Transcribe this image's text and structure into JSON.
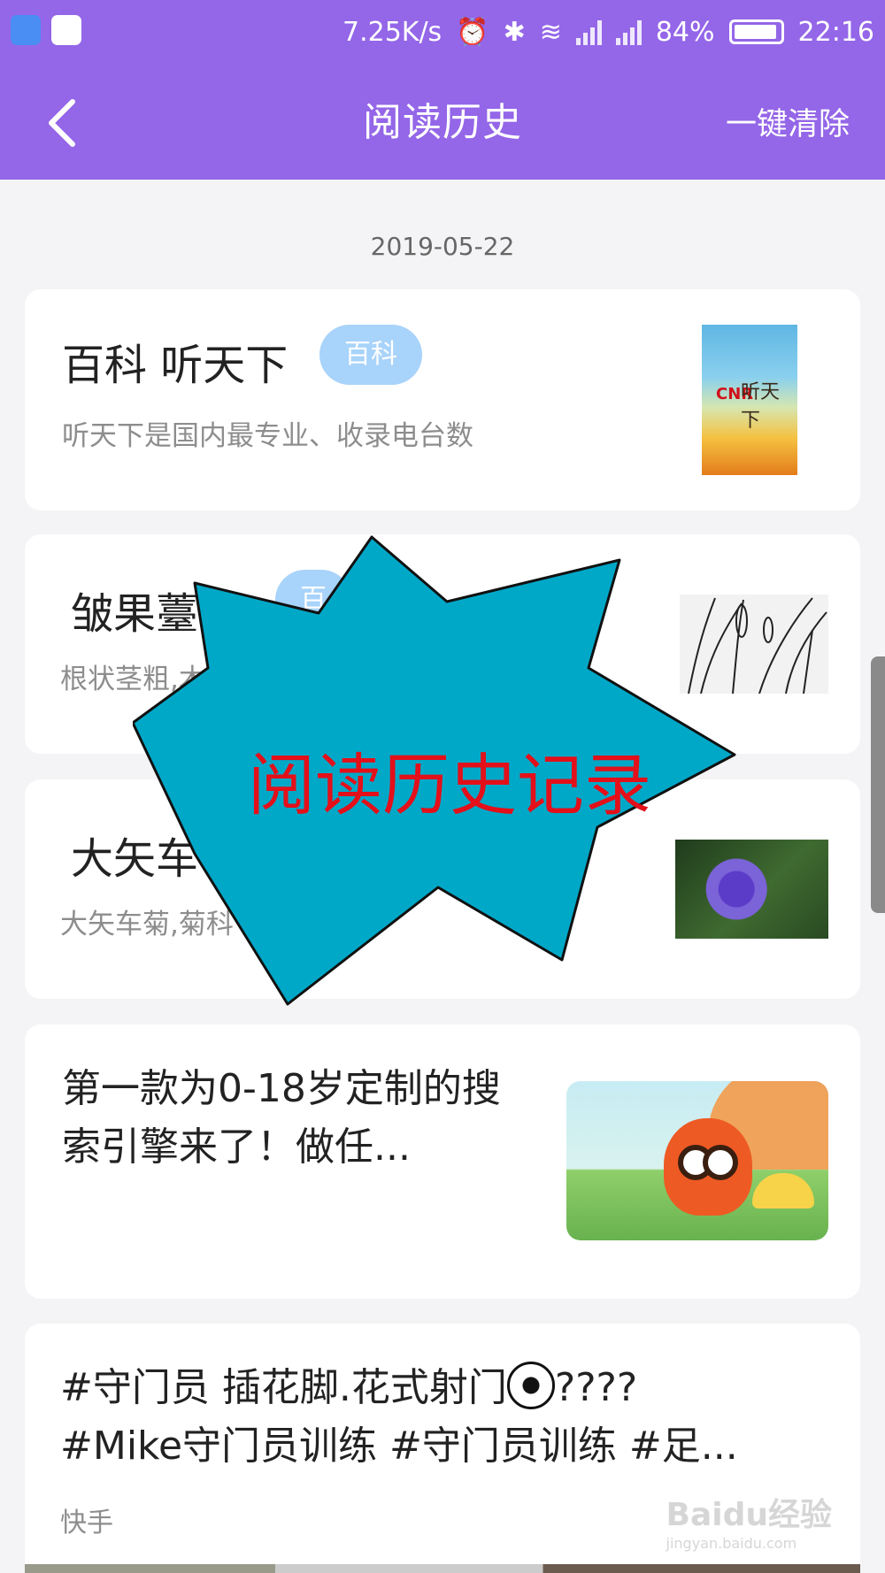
{
  "status_bar": {
    "speed": "7.25K/s",
    "battery": "84%",
    "time": "22:16"
  },
  "header": {
    "title": "阅读历史",
    "clear_label": "一键清除"
  },
  "date": "2019-05-22",
  "cards": [
    {
      "title": "百科 听天下",
      "tag": "百科",
      "desc": "听天下是国内最专业、收录电台数",
      "thumb_cnr": "CNR",
      "thumb_cn": "听天下"
    },
    {
      "title": "皱果薹草",
      "tag": "百",
      "desc": "根状茎粗,木质"
    },
    {
      "title": "大矢车",
      "desc": "大矢车菊,菊科"
    },
    {
      "title": "第一款为0-18岁定制的搜索引擎来了！做任..."
    },
    {
      "title_a": "#守门员 插花脚.花式射门",
      "title_b": "????",
      "title_c": "#Mike守门员训练 #守门员训练 #足...",
      "source": "快手"
    }
  ],
  "overlay": {
    "text": "阅读历史记录"
  },
  "watermark": {
    "brand": "Baidu经验",
    "url": "jingyan.baidu.com"
  },
  "colors": {
    "header_bg": "#9466e8",
    "tag_bg": "#a8d3fa",
    "burst_fill": "#00a8c8",
    "overlay_text": "#e3101a"
  }
}
